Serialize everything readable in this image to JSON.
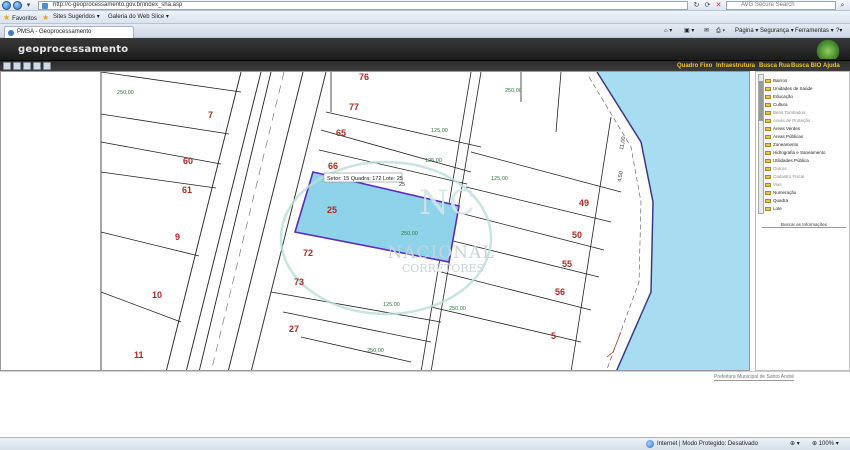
{
  "browser": {
    "address": "http://c-geoprocessamento.gov.br/index_sha.asp",
    "search_placeholder": "AVG Secure Search",
    "favorites_label": "Favoritos",
    "fav_suggested": "Sites Sugeridos",
    "fav_gallery": "Galeria do Web Slice",
    "tab_title": "PMSA - Geoprocessamento",
    "cmd_page": "Página",
    "cmd_safety": "Segurança",
    "cmd_tools": "Ferramentas",
    "cmd_help": "?"
  },
  "app": {
    "title": "geoprocessamento",
    "menus": [
      "Quadro Fixo",
      "Infraestrutura",
      "Busca Rua",
      "Busca BIO",
      "Ajuda"
    ]
  },
  "map": {
    "lot_labels": [
      "76",
      "77",
      "65",
      "66",
      "7",
      "60",
      "61",
      "9",
      "10",
      "11",
      "25",
      "72",
      "73",
      "27",
      "49",
      "50",
      "55",
      "56",
      "5"
    ],
    "dimension_labels": [
      "250,00",
      "25",
      "125,00",
      "250,00",
      "125,00",
      "125,00",
      "250,00",
      "250,00",
      "125,00",
      "250,00",
      "11,00",
      "4,50"
    ],
    "tooltip": "Setor: 15  Quadra: 172  Lote: 25",
    "watermark_main": "NACIONAL",
    "watermark_sub": "CORRETORES",
    "watermark_mark": "NC",
    "water_color": "#a8dcf0",
    "selection_color": "#8fd3ea",
    "selection_stroke": "#5a2bbf",
    "lot_label_color": "#b5281f"
  },
  "layers": {
    "items": [
      {
        "label": "Bairros",
        "dim": false
      },
      {
        "label": "Unidades de Saúde",
        "dim": false
      },
      {
        "label": "Educação",
        "dim": false
      },
      {
        "label": "Cultura",
        "dim": false
      },
      {
        "label": "Bens Tombados",
        "dim": true
      },
      {
        "label": "Áreas de Proteção",
        "dim": true
      },
      {
        "label": "Áreas Verdes",
        "dim": false
      },
      {
        "label": "Áreas Públicas",
        "dim": false
      },
      {
        "label": "Zoneamento",
        "dim": false
      },
      {
        "label": "Hidrografia e Saneamento",
        "dim": false
      },
      {
        "label": "Utilidades Pública",
        "dim": false
      },
      {
        "label": "Outros",
        "dim": true
      },
      {
        "label": "Cadastro Fiscal",
        "dim": true
      },
      {
        "label": "Vias",
        "dim": true
      },
      {
        "label": "Numeração",
        "dim": false
      },
      {
        "label": "Quadra",
        "dim": false
      },
      {
        "label": "Lote",
        "dim": false
      }
    ],
    "info_button": "Buscar as Informações"
  },
  "footer": {
    "credit": "Prefeitura Municipal de Santo André"
  },
  "status": {
    "zone": "Internet | Modo Protegido: Desativado",
    "zoom": "100%"
  }
}
